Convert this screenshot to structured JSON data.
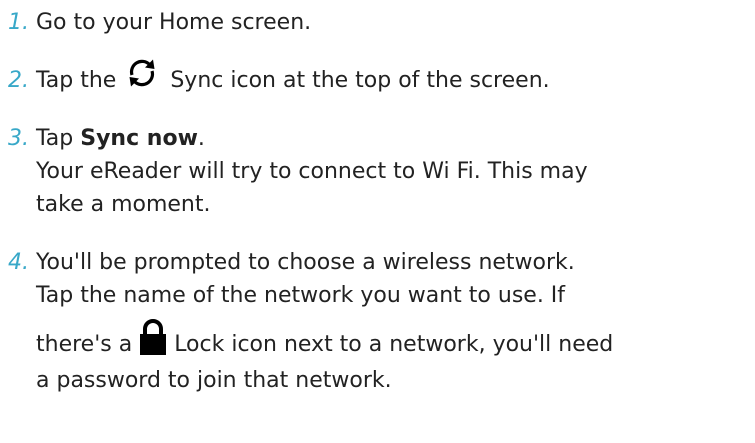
{
  "colors": {
    "step_number": "#38a8c8",
    "text": "#222222",
    "icon": "#000000"
  },
  "steps": [
    {
      "number": "1.",
      "line1": "Go to your Home screen."
    },
    {
      "number": "2.",
      "before_icon": "Tap the",
      "icon": "sync-icon",
      "after_icon": "Sync icon at the top of the screen."
    },
    {
      "number": "3.",
      "prefix": "Tap",
      "bold": "Sync now",
      "suffix": ".",
      "line2": "Your eReader will try to connect to Wi Fi. This may",
      "line3": "take a moment."
    },
    {
      "number": "4.",
      "line1": "You'll be prompted to choose a wireless network.",
      "line2": "Tap the name of the network you want to use. If",
      "before_icon": "there's a",
      "icon": "lock-icon",
      "after_icon": "Lock icon next to a network, you'll need",
      "line4": "a password to join that network."
    }
  ]
}
